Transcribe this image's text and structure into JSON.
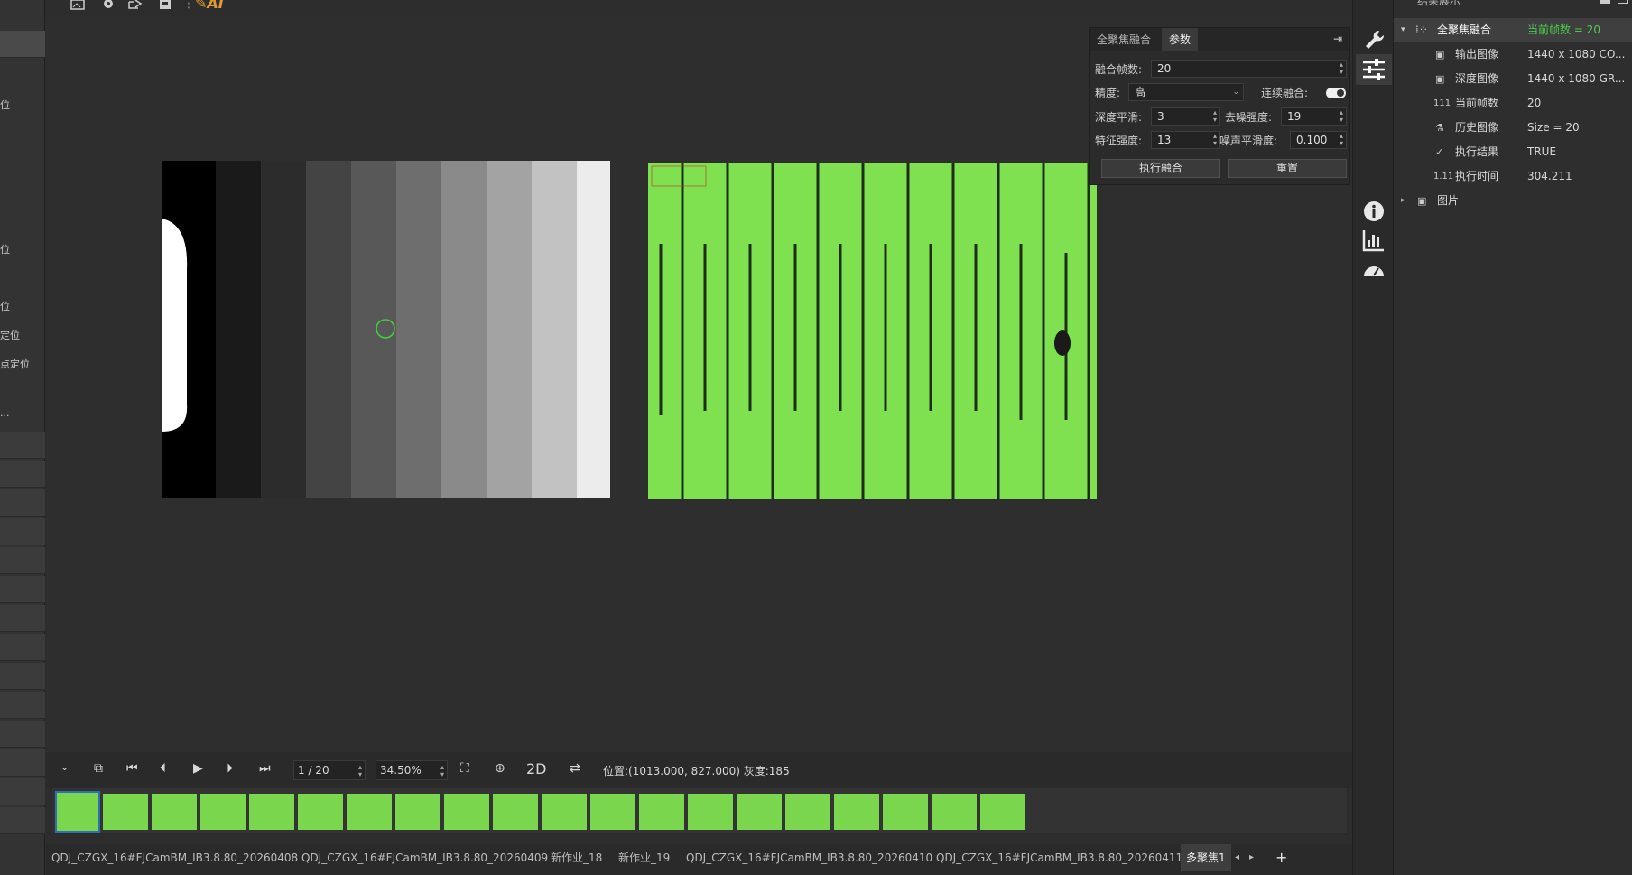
{
  "left_panel": {
    "items": [
      "位",
      "位",
      "位",
      "定位",
      "点定位",
      "..."
    ]
  },
  "toolbar": {
    "ai_label": "AI",
    "icons": [
      "image-add-icon",
      "gear-icon",
      "export-icon",
      "save-icon",
      "ai-pen-icon"
    ]
  },
  "params_panel": {
    "tabs": [
      "全聚焦融合",
      "参数"
    ],
    "active_tab": "参数",
    "fusion_frames_label": "融合帧数:",
    "fusion_frames_value": "20",
    "precision_label": "精度:",
    "precision_value": "高",
    "continuous_label": "连续融合:",
    "continuous_on": true,
    "depth_smooth_label": "深度平滑:",
    "depth_smooth_value": "3",
    "denoise_label": "去噪强度:",
    "denoise_value": "19",
    "feature_label": "特征强度:",
    "feature_value": "13",
    "noise_smooth_label": "噪声平滑度:",
    "noise_smooth_value": "0.100",
    "run_button": "执行融合",
    "reset_button": "重置"
  },
  "sidebar_icons": [
    "wrench-icon",
    "sliders-icon",
    "info-icon",
    "bar-chart-icon",
    "gauge-icon"
  ],
  "results": {
    "header": "结果展示",
    "root_label": "全聚焦融合",
    "root_value": "当前帧数 = 20",
    "rows": [
      {
        "label": "输出图像",
        "value": "1440 x 1080 CO..."
      },
      {
        "label": "深度图像",
        "value": "1440 x 1080 GR..."
      },
      {
        "label": "当前帧数",
        "value": "20"
      },
      {
        "label": "历史图像",
        "value": "Size = 20"
      },
      {
        "label": "执行结果",
        "value": "TRUE"
      },
      {
        "label": "执行时间",
        "value": "304.211"
      }
    ],
    "image_node": "图片"
  },
  "film_bar": {
    "frame": "1 / 20",
    "zoom": "34.50%",
    "mode": "2D",
    "position_label": "位置:",
    "position_value": "(1013.000, 827.000)",
    "gray_label": "灰度:",
    "gray_value": "185",
    "thumb_count": 20
  },
  "doc_tabs": [
    "QDJ_CZGX_16#FJCamBM_IB3.8.80_20260408",
    "QDJ_CZGX_16#FJCamBM_IB3.8.80_20260409",
    "新作业_18",
    "新作业_19",
    "QDJ_CZGX_16#FJCamBM_IB3.8.80_20260410",
    "QDJ_CZGX_16#FJCamBM_IB3.8.80_20260411",
    "多聚焦1"
  ],
  "active_doc_tab": "多聚焦1",
  "colors": {
    "accent_green": "#4ec94e",
    "image_green": "#7fe14f",
    "selection_blue": "#2f6fb3"
  }
}
